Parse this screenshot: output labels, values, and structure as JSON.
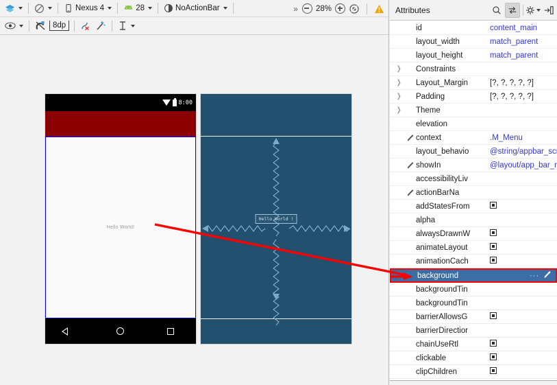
{
  "toolbar": {
    "layers_icon": "layers-icon",
    "orientation_icon": "orientation-icon",
    "device_icon": "phone-icon",
    "device_label": "Nexus 4",
    "api_icon": "android-icon",
    "api_label": "28",
    "theme_icon": "theme-contrast-icon",
    "theme_label": "NoActionBar",
    "overflow_label": "»",
    "zoom_out_icon": "zoom-out-icon",
    "zoom_level": "28%",
    "zoom_in_icon": "zoom-in-icon",
    "zoom_fit_icon": "zoom-to-fit-icon",
    "warning_icon": "warning-icon"
  },
  "toolbar2": {
    "eye_icon": "visibility-icon",
    "magnet_icon": "autoconnect-magnet-icon",
    "margin_icon": "default-margin-icon",
    "margin_value": "8dp",
    "clear_constraints_icon": "clear-constraints-icon",
    "infer_constraints_icon": "infer-constraints-icon",
    "guideline_icon": "guidelines-icon"
  },
  "device_preview": {
    "status_bar": {
      "wifi_icon": "wifi-icon",
      "battery_icon": "battery-icon",
      "time": "8:00"
    },
    "appbar_color": "#8b0000",
    "content_text": "Hello World!",
    "nav_bar": {
      "back_icon": "nav-back-icon",
      "home_icon": "nav-home-icon",
      "recents_icon": "nav-recents-icon"
    }
  },
  "blueprint_preview": {
    "background_color": "#23506f",
    "widget_label": "Hello World !"
  },
  "attributes_panel": {
    "title": "Attributes",
    "search_icon": "search-icon",
    "toggle_icon": "toggle-expert-mode-icon",
    "settings_icon": "gear-icon",
    "collapse_icon": "collapse-panel-icon",
    "rows": [
      {
        "expand": false,
        "pen": false,
        "name": "id",
        "value": "content_main",
        "link": true,
        "checkbox": false
      },
      {
        "expand": false,
        "pen": false,
        "name": "layout_width",
        "value": "match_parent",
        "link": true,
        "checkbox": false
      },
      {
        "expand": false,
        "pen": false,
        "name": "layout_height",
        "value": "match_parent",
        "link": true,
        "checkbox": false
      },
      {
        "expand": true,
        "pen": false,
        "name": "Constraints",
        "value": "",
        "link": false,
        "checkbox": false
      },
      {
        "expand": true,
        "pen": false,
        "name": "Layout_Margin",
        "value": "[?, ?, ?, ?, ?]",
        "link": false,
        "checkbox": false
      },
      {
        "expand": true,
        "pen": false,
        "name": "Padding",
        "value": "[?, ?, ?, ?, ?]",
        "link": false,
        "checkbox": false
      },
      {
        "expand": true,
        "pen": false,
        "name": "Theme",
        "value": "",
        "link": false,
        "checkbox": false
      },
      {
        "expand": false,
        "pen": false,
        "name": "elevation",
        "value": "",
        "link": false,
        "checkbox": false
      },
      {
        "expand": false,
        "pen": true,
        "name": "context",
        "value": ".M_Menu",
        "link": true,
        "checkbox": false
      },
      {
        "expand": false,
        "pen": false,
        "name": "layout_behavio",
        "value": "@string/appbar_scroll",
        "link": true,
        "checkbox": false
      },
      {
        "expand": false,
        "pen": true,
        "name": "showIn",
        "value": "@layout/app_bar_m_",
        "link": true,
        "checkbox": false
      },
      {
        "expand": false,
        "pen": false,
        "name": "accessibilityLiv",
        "value": "",
        "link": false,
        "checkbox": false
      },
      {
        "expand": false,
        "pen": true,
        "name": "actionBarNa",
        "value": "",
        "link": false,
        "checkbox": false
      },
      {
        "expand": false,
        "pen": false,
        "name": "addStatesFrom",
        "value": "",
        "link": false,
        "checkbox": true
      },
      {
        "expand": false,
        "pen": false,
        "name": "alpha",
        "value": "",
        "link": false,
        "checkbox": false
      },
      {
        "expand": false,
        "pen": false,
        "name": "alwaysDrawnW",
        "value": "",
        "link": false,
        "checkbox": true
      },
      {
        "expand": false,
        "pen": false,
        "name": "animateLayout",
        "value": "",
        "link": false,
        "checkbox": true
      },
      {
        "expand": false,
        "pen": false,
        "name": "animationCach",
        "value": "",
        "link": false,
        "checkbox": true
      },
      {
        "expand": false,
        "pen": false,
        "name": "background",
        "value": "",
        "link": false,
        "checkbox": false,
        "selected": true,
        "dots": "···",
        "brush_icon": "brush-icon"
      },
      {
        "expand": false,
        "pen": false,
        "name": "backgroundTin",
        "value": "",
        "link": false,
        "checkbox": false
      },
      {
        "expand": false,
        "pen": false,
        "name": "backgroundTin",
        "value": "",
        "link": false,
        "checkbox": false
      },
      {
        "expand": false,
        "pen": false,
        "name": "barrierAllowsG",
        "value": "",
        "link": false,
        "checkbox": true
      },
      {
        "expand": false,
        "pen": false,
        "name": "barrierDirectior",
        "value": "",
        "link": false,
        "checkbox": false
      },
      {
        "expand": false,
        "pen": false,
        "name": "chainUseRtl",
        "value": "",
        "link": false,
        "checkbox": true
      },
      {
        "expand": false,
        "pen": false,
        "name": "clickable",
        "value": "",
        "link": false,
        "checkbox": true
      },
      {
        "expand": false,
        "pen": false,
        "name": "clipChildren",
        "value": "",
        "link": false,
        "checkbox": true
      }
    ]
  },
  "annotation": {
    "arrow_color": "#fe0000",
    "highlight_color": "#fe0000"
  }
}
